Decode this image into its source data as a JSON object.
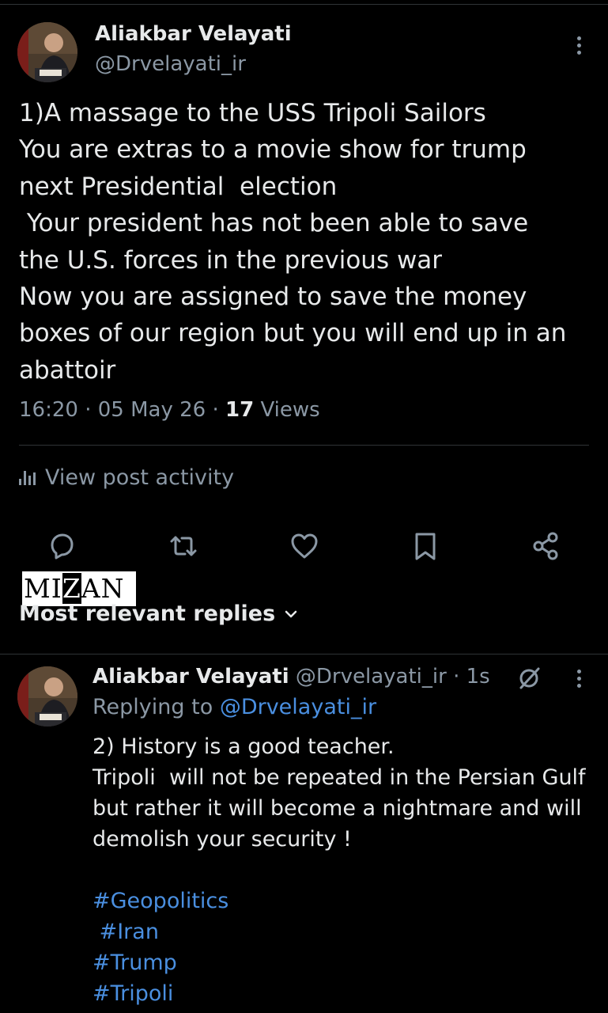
{
  "post": {
    "author_name": "Aliakbar Velayati",
    "author_handle": "@Drvelayati_ir",
    "lines": [
      "1)A massage to the USS Tripoli Sailors",
      "You are extras to a movie show for trump",
      "next Presidential  election",
      " Your president has not been able to save",
      "the U.S. forces in the previous war",
      "Now you are assigned to save the money",
      "boxes of our region but you will end up in an",
      "abattoir"
    ],
    "time": "16:20",
    "date": "05 May 26",
    "views_count": "17",
    "views_label": "Views",
    "sep": " · ",
    "activity_label": "View post activity"
  },
  "actions": {
    "icons": [
      "reply-icon",
      "repost-icon",
      "like-icon",
      "bookmark-icon",
      "share-icon"
    ]
  },
  "watermark": {
    "pre": "MI",
    "z": "Z",
    "post": "AN"
  },
  "replies_header": {
    "label": "Most relevant replies",
    "icon": "chevron-down-icon"
  },
  "reply": {
    "author_name": "Aliakbar Velayati",
    "author_handle": "@Drvelayati_ir",
    "age": "1s",
    "sep": " · ",
    "replying_prefix": "Replying to ",
    "replying_handle": "@Drvelayati_ir",
    "lines": [
      "2) History is a good teacher.",
      "Tripoli  will not be repeated in the Persian Gulf",
      "but rather it will become a nightmare and will",
      "demolish your security !"
    ],
    "hashtags": [
      "#Geopolitics",
      " #Iran",
      "#Trump",
      "#Tripoli"
    ]
  },
  "colors": {
    "background": "#000000",
    "text": "#e7e9ea",
    "muted": "#8b98a5",
    "link": "#4a8fe0"
  }
}
